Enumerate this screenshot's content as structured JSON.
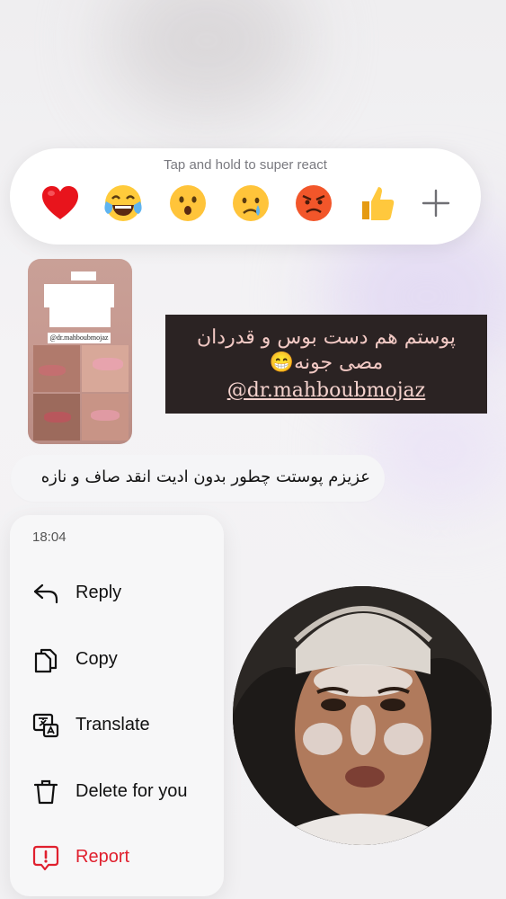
{
  "reaction_bar": {
    "hint": "Tap and hold to super react",
    "emojis": [
      "red-heart",
      "tears-of-joy",
      "surprised-face",
      "crying-face",
      "angry-face",
      "thumbs-up"
    ],
    "add_label": "+"
  },
  "shared_story": {
    "thumb_tag": "@dr.mahboubmojaz",
    "caption": "پوستم هم دست بوس و قدردان مصی جونه😁",
    "handle": "@dr.mahboubmojaz"
  },
  "message": {
    "text": "عزیزم پوستت چطور بدون ادیت انقد صاف و نازه"
  },
  "context_menu": {
    "time": "18:04",
    "items": [
      {
        "label": "Reply",
        "icon": "reply-icon"
      },
      {
        "label": "Copy",
        "icon": "copy-icon"
      },
      {
        "label": "Translate",
        "icon": "translate-icon"
      },
      {
        "label": "Delete for you",
        "icon": "trash-icon"
      },
      {
        "label": "Report",
        "icon": "report-icon"
      }
    ]
  },
  "colors": {
    "danger": "#e0202e",
    "caption_bg": "#2b2323",
    "caption_text": "#f2c9c4"
  }
}
